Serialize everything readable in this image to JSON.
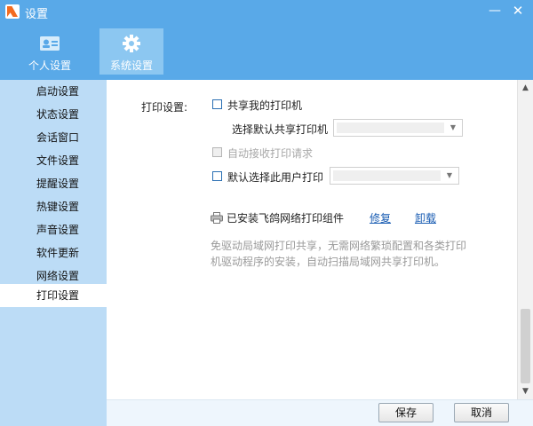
{
  "window": {
    "title": "设置",
    "minimize": "—",
    "close": "✕"
  },
  "top_tabs": [
    {
      "label": "个人设置",
      "icon": "id-card-icon"
    },
    {
      "label": "系统设置",
      "icon": "gear-icon"
    }
  ],
  "sidebar": {
    "items": [
      {
        "label": "启动设置"
      },
      {
        "label": "状态设置"
      },
      {
        "label": "会话窗口"
      },
      {
        "label": "文件设置"
      },
      {
        "label": "提醒设置"
      },
      {
        "label": "热键设置"
      },
      {
        "label": "声音设置"
      },
      {
        "label": "软件更新"
      },
      {
        "label": "网络设置"
      },
      {
        "label": "打印设置"
      }
    ],
    "active": "打印设置"
  },
  "print_settings": {
    "section_label": "打印设置:",
    "share_printer": {
      "label": "共享我的打印机",
      "checked": false
    },
    "default_share_label": "选择默认共享打印机",
    "default_share_value": "",
    "auto_accept": {
      "label": "自动接收打印请求",
      "checked": false,
      "disabled": true
    },
    "default_user_print": {
      "label": "默认选择此用户打印",
      "checked": false
    },
    "default_user_value": "",
    "component_status": "已安装飞鸽网络打印组件",
    "repair_link": "修复",
    "uninstall_link": "卸载",
    "description": "免驱动局域网打印共享，无需网络繁琐配置和各类打印机驱动程序的安装，自动扫描局域网共享打印机。"
  },
  "footer": {
    "save": "保存",
    "cancel": "取消"
  },
  "colors": {
    "titlebar": "#59a9e8",
    "active_tab": "#8cc7f1",
    "sidebar": "#bcdcf6",
    "link": "#1a5db3"
  }
}
